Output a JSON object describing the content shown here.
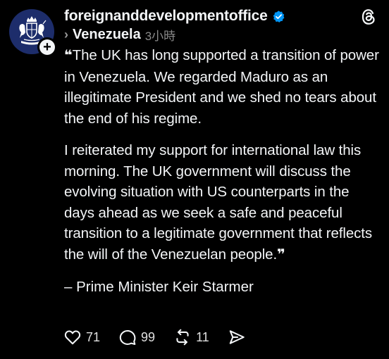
{
  "account": {
    "username": "foreignanddevelopmentoffice",
    "verified_icon": "verified-badge-icon",
    "avatar_icon": "royal-coat-of-arms-icon",
    "follow_icon": "plus-icon"
  },
  "topic": {
    "label": "Venezuela",
    "time": "3小時"
  },
  "post": {
    "paragraph1_open_quote": "❝",
    "paragraph1": "The UK has long supported a transition of power in Venezuela. We regarded Maduro as an illegitimate President and we shed no tears about the end of his regime.",
    "paragraph2": "I reiterated my support for international law this morning. The UK government will discuss the evolving situation with US counterparts in the days ahead as we seek a safe and peaceful transition to a legitimate government that reflects the will of the Venezuelan people.",
    "paragraph2_close_quote": "❞",
    "attribution": "– Prime Minister Keir Starmer"
  },
  "actions": {
    "likes": "71",
    "replies": "99",
    "reposts": "11"
  },
  "colors": {
    "background": "#000000",
    "text": "#f3f5f7",
    "muted": "#8a8a8a",
    "verified": "#0095f6",
    "avatar_bg": "#1d2d6b"
  }
}
